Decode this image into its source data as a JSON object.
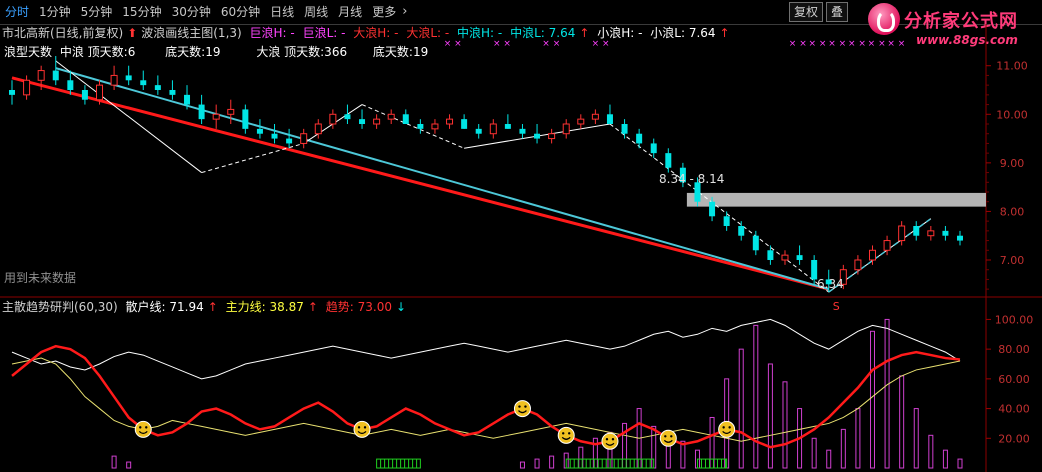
{
  "toolbar": {
    "tabs": [
      {
        "label": "分时",
        "active": true
      },
      {
        "label": "1分钟"
      },
      {
        "label": "5分钟"
      },
      {
        "label": "15分钟"
      },
      {
        "label": "30分钟"
      },
      {
        "label": "60分钟"
      },
      {
        "label": "日线"
      },
      {
        "label": "周线"
      },
      {
        "label": "月线"
      },
      {
        "label": "更多"
      }
    ],
    "restore_label": "复权",
    "overlay_label": "叠"
  },
  "logo": {
    "title": "分析家公式网",
    "url": "www.88gs.com"
  },
  "main_legend": {
    "stock": "市北高新(日线,前复权)",
    "indicator": "波浪画线主图(1,3)",
    "huge_h": "巨浪H: -",
    "huge_l": "巨浪L: -",
    "big_h": "大浪H: -",
    "big_l": "大浪L: -",
    "mid_h": "中浪H: -",
    "mid_l": "中浪L: 7.64",
    "small_h": "小浪H: -",
    "small_l": "小浪L: 7.64",
    "row2_a": "浪型天数",
    "row2_b": "中浪 顶天数:6",
    "row2_c": "底天数:19",
    "row2_d": "大浪 顶天数:366",
    "row2_e": "底天数:19",
    "future_note": "用到未来数据",
    "range_label": "8.34 - 8.14",
    "low_label": "6.34",
    "colors": {
      "up": "#ff3232",
      "down": "#00e5e5",
      "wave": "#ffffff",
      "trend_red": "#ff1a1a",
      "trend_cyan": "#4dc8d8",
      "band": "#b4b4b4"
    }
  },
  "main_axis": {
    "ticks": [
      "11.00",
      "10.00",
      "9.00",
      "8.00",
      "7.00"
    ]
  },
  "sub_legend": {
    "name": "主散趋势研判(60,30)",
    "retail": "散户线: 71.94",
    "main_force": "主力线: 38.87",
    "trend": "趋势: 73.00"
  },
  "sub_axis": {
    "ticks": [
      "100.00",
      "80.00",
      "60.00",
      "40.00",
      "20.00"
    ]
  },
  "chart_data": {
    "type": "candlestick",
    "price_range": [
      6.3,
      11.2
    ],
    "candles": [
      [
        10.5,
        10.7,
        10.2,
        10.4
      ],
      [
        10.4,
        10.8,
        10.3,
        10.7
      ],
      [
        10.7,
        11.0,
        10.5,
        10.9
      ],
      [
        10.9,
        11.2,
        10.6,
        10.7
      ],
      [
        10.7,
        10.9,
        10.4,
        10.5
      ],
      [
        10.5,
        10.6,
        10.2,
        10.3
      ],
      [
        10.3,
        10.7,
        10.2,
        10.6
      ],
      [
        10.6,
        11.0,
        10.5,
        10.8
      ],
      [
        10.8,
        11.0,
        10.6,
        10.7
      ],
      [
        10.7,
        10.9,
        10.5,
        10.6
      ],
      [
        10.6,
        10.8,
        10.4,
        10.5
      ],
      [
        10.5,
        10.7,
        10.3,
        10.4
      ],
      [
        10.4,
        10.6,
        10.1,
        10.2
      ],
      [
        10.2,
        10.4,
        9.8,
        9.9
      ],
      [
        9.9,
        10.2,
        9.7,
        10.0
      ],
      [
        10.0,
        10.3,
        9.8,
        10.1
      ],
      [
        10.1,
        10.2,
        9.6,
        9.7
      ],
      [
        9.7,
        9.9,
        9.5,
        9.6
      ],
      [
        9.6,
        9.8,
        9.4,
        9.5
      ],
      [
        9.5,
        9.7,
        9.3,
        9.4
      ],
      [
        9.4,
        9.7,
        9.3,
        9.6
      ],
      [
        9.6,
        9.9,
        9.5,
        9.8
      ],
      [
        9.8,
        10.1,
        9.7,
        10.0
      ],
      [
        10.0,
        10.2,
        9.8,
        9.9
      ],
      [
        9.9,
        10.1,
        9.7,
        9.8
      ],
      [
        9.8,
        10.0,
        9.7,
        9.9
      ],
      [
        9.9,
        10.1,
        9.8,
        10.0
      ],
      [
        10.0,
        10.1,
        9.8,
        9.8
      ],
      [
        9.8,
        9.9,
        9.6,
        9.7
      ],
      [
        9.7,
        9.9,
        9.6,
        9.8
      ],
      [
        9.8,
        10.0,
        9.7,
        9.9
      ],
      [
        9.9,
        10.0,
        9.7,
        9.7
      ],
      [
        9.7,
        9.8,
        9.5,
        9.6
      ],
      [
        9.6,
        9.9,
        9.5,
        9.8
      ],
      [
        9.8,
        10.0,
        9.7,
        9.7
      ],
      [
        9.7,
        9.8,
        9.5,
        9.6
      ],
      [
        9.6,
        9.8,
        9.4,
        9.5
      ],
      [
        9.5,
        9.7,
        9.4,
        9.6
      ],
      [
        9.6,
        9.9,
        9.5,
        9.8
      ],
      [
        9.8,
        10.0,
        9.7,
        9.9
      ],
      [
        9.9,
        10.1,
        9.8,
        10.0
      ],
      [
        10.0,
        10.2,
        9.8,
        9.8
      ],
      [
        9.8,
        9.9,
        9.5,
        9.6
      ],
      [
        9.6,
        9.7,
        9.3,
        9.4
      ],
      [
        9.4,
        9.5,
        9.1,
        9.2
      ],
      [
        9.2,
        9.3,
        8.8,
        8.9
      ],
      [
        8.9,
        9.0,
        8.5,
        8.6
      ],
      [
        8.6,
        8.7,
        8.1,
        8.2
      ],
      [
        8.2,
        8.3,
        7.8,
        7.9
      ],
      [
        7.9,
        8.0,
        7.6,
        7.7
      ],
      [
        7.7,
        7.8,
        7.4,
        7.5
      ],
      [
        7.5,
        7.6,
        7.1,
        7.2
      ],
      [
        7.2,
        7.3,
        6.9,
        7.0
      ],
      [
        7.0,
        7.2,
        6.9,
        7.1
      ],
      [
        7.1,
        7.3,
        6.9,
        7.0
      ],
      [
        7.0,
        7.1,
        6.5,
        6.6
      ],
      [
        6.6,
        6.8,
        6.34,
        6.5
      ],
      [
        6.5,
        6.9,
        6.4,
        6.8
      ],
      [
        6.8,
        7.1,
        6.7,
        7.0
      ],
      [
        7.0,
        7.3,
        6.9,
        7.2
      ],
      [
        7.2,
        7.5,
        7.1,
        7.4
      ],
      [
        7.4,
        7.8,
        7.3,
        7.7
      ],
      [
        7.7,
        7.8,
        7.4,
        7.5
      ],
      [
        7.5,
        7.7,
        7.4,
        7.6
      ],
      [
        7.6,
        7.7,
        7.4,
        7.5
      ],
      [
        7.5,
        7.6,
        7.3,
        7.4
      ]
    ],
    "sub_range": [
      0,
      105
    ],
    "retail_line": [
      78,
      74,
      70,
      72,
      68,
      66,
      70,
      75,
      78,
      76,
      72,
      68,
      64,
      60,
      62,
      66,
      70,
      72,
      74,
      76,
      78,
      80,
      82,
      80,
      78,
      76,
      74,
      76,
      78,
      80,
      82,
      84,
      82,
      80,
      78,
      80,
      82,
      84,
      86,
      84,
      82,
      80,
      82,
      86,
      90,
      92,
      88,
      90,
      94,
      92,
      96,
      98,
      100,
      96,
      90,
      84,
      80,
      86,
      92,
      96,
      94,
      90,
      86,
      82,
      78,
      72
    ],
    "main_line": [
      70,
      72,
      74,
      70,
      60,
      48,
      40,
      32,
      28,
      26,
      28,
      32,
      30,
      28,
      26,
      24,
      22,
      24,
      26,
      28,
      30,
      28,
      26,
      24,
      22,
      24,
      26,
      24,
      22,
      24,
      26,
      24,
      22,
      20,
      22,
      24,
      26,
      28,
      30,
      28,
      26,
      24,
      22,
      20,
      22,
      24,
      26,
      24,
      22,
      20,
      18,
      20,
      22,
      24,
      26,
      28,
      30,
      34,
      40,
      48,
      56,
      62,
      66,
      68,
      70,
      72
    ],
    "trend_line": [
      62,
      70,
      78,
      82,
      80,
      74,
      62,
      48,
      34,
      26,
      22,
      24,
      30,
      38,
      40,
      36,
      30,
      26,
      28,
      34,
      40,
      44,
      38,
      30,
      26,
      28,
      34,
      40,
      36,
      30,
      26,
      22,
      24,
      30,
      36,
      40,
      36,
      28,
      22,
      18,
      16,
      18,
      24,
      30,
      26,
      20,
      16,
      18,
      22,
      26,
      24,
      18,
      14,
      16,
      20,
      26,
      34,
      44,
      54,
      66,
      72,
      76,
      78,
      76,
      74,
      73
    ],
    "bars": [
      0,
      0,
      0,
      0,
      0,
      0,
      0,
      8,
      4,
      0,
      0,
      0,
      0,
      0,
      0,
      0,
      0,
      0,
      0,
      0,
      0,
      0,
      0,
      0,
      0,
      0,
      0,
      0,
      0,
      0,
      0,
      0,
      0,
      0,
      0,
      4,
      6,
      8,
      10,
      14,
      20,
      24,
      30,
      40,
      28,
      22,
      18,
      12,
      34,
      60,
      80,
      96,
      70,
      58,
      40,
      20,
      12,
      26,
      40,
      92,
      100,
      62,
      40,
      22,
      12,
      6
    ],
    "signals": [
      9,
      24,
      35,
      38,
      41,
      45,
      49
    ]
  }
}
